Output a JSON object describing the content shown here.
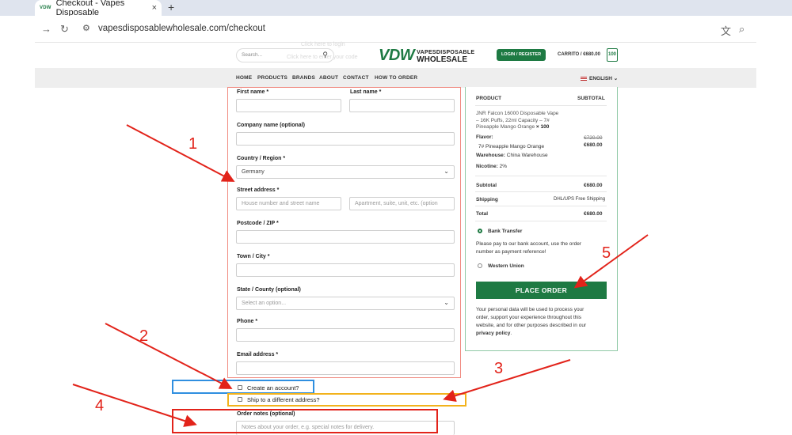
{
  "browser": {
    "tab_favicon_text": "VDW",
    "tab_title": "Checkout - Vapes Disposable",
    "tab_close": "×",
    "new_tab": "+",
    "url": "vapesdisposablewholesale.com/checkout"
  },
  "header": {
    "search_placeholder": "Search...",
    "logo_mark": "VDW",
    "logo_line1": "VAPESDISPOSABLE",
    "logo_line2": "WHOLESALE",
    "login_label": "LOGIN / REGISTER",
    "cart_label": "CARRITO / €680.00",
    "cart_count": "100",
    "faint_line1": "Click here to login",
    "faint_line2": "Click here to enter your code"
  },
  "nav": {
    "items": [
      "HOME",
      "PRODUCTS",
      "BRANDS",
      "ABOUT",
      "CONTACT",
      "HOW TO ORDER"
    ],
    "language": "ENGLISH"
  },
  "form": {
    "first_name_label": "First name *",
    "last_name_label": "Last name *",
    "company_label": "Company name (optional)",
    "country_label": "Country / Region *",
    "country_value": "Germany",
    "street_label": "Street address *",
    "street_placeholder": "House number and street name",
    "street2_placeholder": "Apartment, suite, unit, etc. (option",
    "postcode_label": "Postcode / ZIP *",
    "town_label": "Town / City *",
    "state_label": "State / County (optional)",
    "state_placeholder": "Select an option...",
    "phone_label": "Phone *",
    "email_label": "Email address *",
    "create_account_label": "Create an account?",
    "ship_different_label": "Ship to a different address?",
    "order_notes_label": "Order notes (optional)",
    "order_notes_placeholder": "Notes about your order, e.g. special notes for delivery."
  },
  "order": {
    "product_header": "PRODUCT",
    "subtotal_header": "SUBTOTAL",
    "product_line1": "JNR Falcon 16000 Disposable Vape",
    "product_line2": "– 16K Puffs, 22ml Capacity – 7#",
    "product_line3": "Pineapple Mango Orange",
    "product_qty": "× 100",
    "flavor_label": "Flavor:",
    "flavor_value": "7# Pineapple Mango Orange",
    "warehouse_label": "Warehouse:",
    "warehouse_value": "China Warehouse",
    "nicotine_label": "Nicotine:",
    "nicotine_value": "2%",
    "old_price": "€720.00",
    "price": "€680.00",
    "subtotal_label": "Subtotal",
    "subtotal_value": "€680.00",
    "shipping_label": "Shipping",
    "shipping_value": "DHL/UPS Free Shipping",
    "total_label": "Total",
    "total_value": "€680.00",
    "bank_label": "Bank Transfer",
    "bank_note_1": "Please pay to our bank account, use the order",
    "bank_note_2": "number as payment reference!",
    "western_label": "Western Union",
    "place_order_label": "PLACE ORDER",
    "privacy_1": "Your personal data will be used to process your",
    "privacy_2": "order, support your experience throughout this",
    "privacy_3": "website, and for other purposes described in our",
    "privacy_link": "privacy policy",
    "privacy_end": "."
  },
  "annotations": {
    "labels": [
      "1",
      "2",
      "3",
      "4",
      "5"
    ],
    "colors": {
      "red": "#e2231a",
      "blue": "#2f8fe0",
      "orange": "#f2b21c"
    }
  }
}
